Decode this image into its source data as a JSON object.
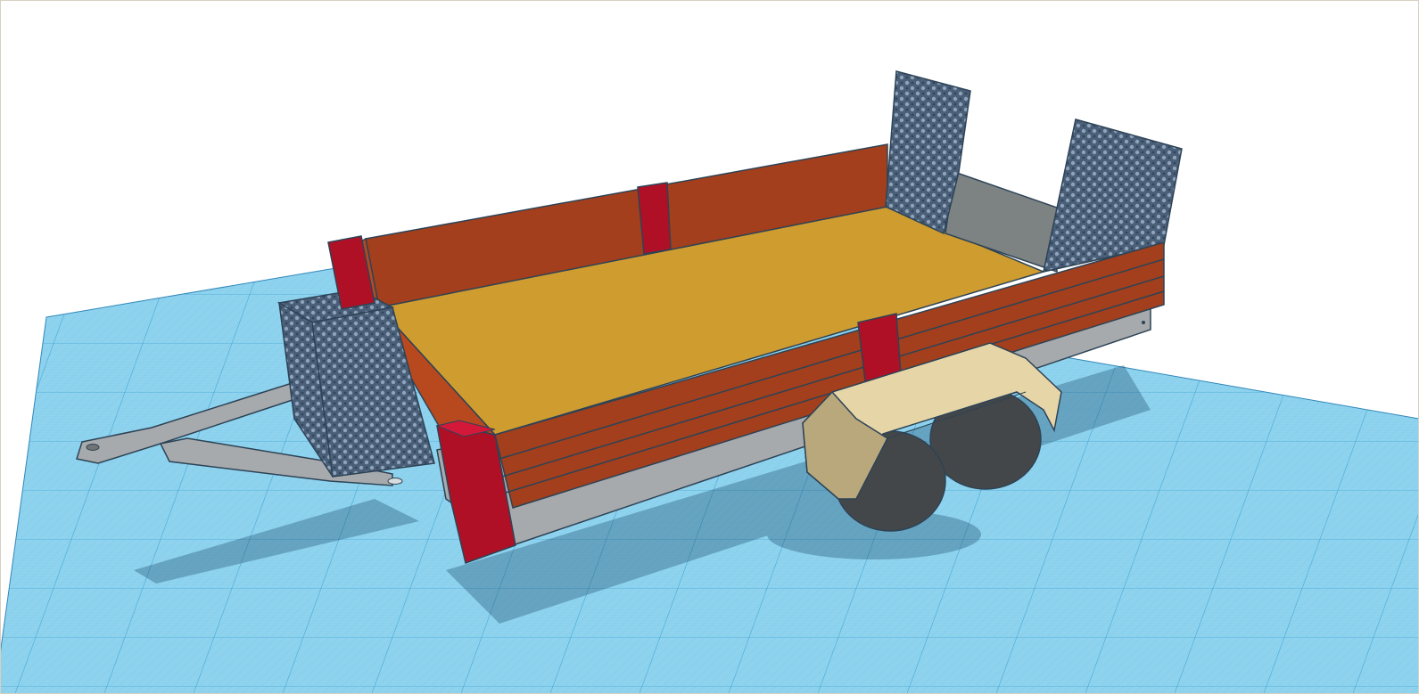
{
  "app": {
    "view": "3d-workplane"
  },
  "scene": {
    "background_color": "#ffffff",
    "workplane": {
      "fill_color": "#8fd3ee",
      "grid_minor_color": "#6bbfe3",
      "grid_major_color": "#3a9fd0",
      "edge_color": "#2f86b8"
    },
    "object": {
      "type": "trailer",
      "parts": {
        "deck_color": "#cf9c30",
        "side_boards_color": "#a33f1c",
        "corner_posts_color": "#b01025",
        "frame_color": "#a7aaac",
        "frame_dark_color": "#707475",
        "mesh_ramps_color": "#4a5f78",
        "mesh_box_color": "#4a5f78",
        "fender_color": "#e6d5a7",
        "fender_dark_color": "#b9a87b",
        "tires_color": "#444749",
        "outline_color": "#2d4356",
        "shadow_color": "#1d4e6d"
      }
    }
  }
}
